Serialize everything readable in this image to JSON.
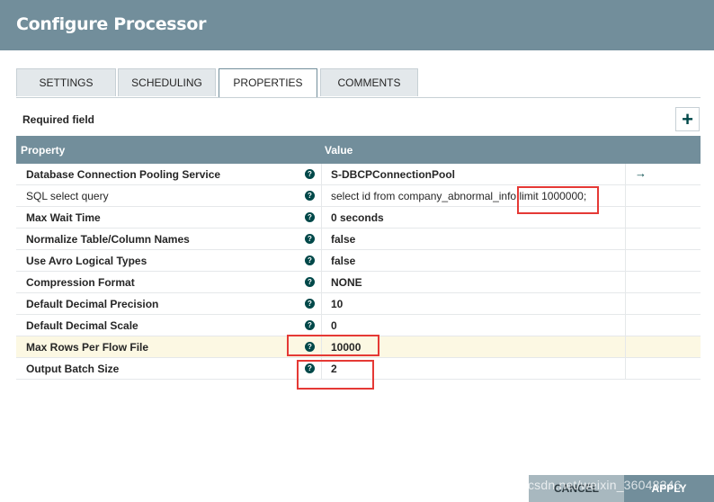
{
  "dialog": {
    "title": "Configure Processor"
  },
  "tabs": [
    {
      "label": "SETTINGS"
    },
    {
      "label": "SCHEDULING"
    },
    {
      "label": "PROPERTIES"
    },
    {
      "label": "COMMENTS"
    }
  ],
  "active_tab": "PROPERTIES",
  "required_label": "Required field",
  "add_button": "+",
  "table": {
    "headers": {
      "property": "Property",
      "value": "Value"
    },
    "rows": [
      {
        "name": "Database Connection Pooling Service",
        "value": "S-DBCPConnectionPool",
        "required": true,
        "help": "?",
        "goto": "→"
      },
      {
        "name": "SQL select query",
        "value": "select id from company_abnormal_info limit 1000000;",
        "required": false,
        "help": "?"
      },
      {
        "name": "Max Wait Time",
        "value": "0 seconds",
        "required": true,
        "help": "?"
      },
      {
        "name": "Normalize Table/Column Names",
        "value": "false",
        "required": true,
        "help": "?"
      },
      {
        "name": "Use Avro Logical Types",
        "value": "false",
        "required": true,
        "help": "?"
      },
      {
        "name": "Compression Format",
        "value": "NONE",
        "required": true,
        "help": "?"
      },
      {
        "name": "Default Decimal Precision",
        "value": "10",
        "required": true,
        "help": "?"
      },
      {
        "name": "Default Decimal Scale",
        "value": "0",
        "required": true,
        "help": "?"
      },
      {
        "name": "Max Rows Per Flow File",
        "value": "10000",
        "required": true,
        "help": "?"
      },
      {
        "name": "Output Batch Size",
        "value": "2",
        "required": true,
        "help": "?"
      }
    ]
  },
  "footer": {
    "cancel": "CANCEL",
    "apply": "APPLY"
  },
  "watermark": "https://blog.csdn.net/weixin_36048246",
  "colors": {
    "header": "#728e9b",
    "accent": "#004849",
    "highlight": "#fcf8e3",
    "annotation": "#e53935"
  }
}
